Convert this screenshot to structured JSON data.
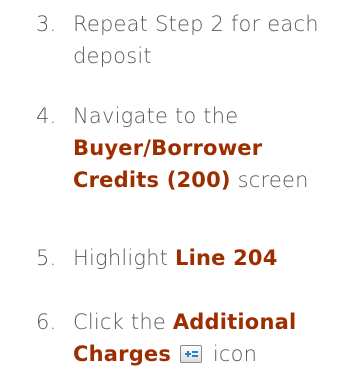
{
  "steps": [
    {
      "number": "3.",
      "text": "Repeat Step 2 for each deposit"
    },
    {
      "number": "4.",
      "prefix": "Navigate to the ",
      "highlight": "Buyer/Borrower Credits (200)",
      "suffix": " screen"
    },
    {
      "number": "5.",
      "prefix": "Highlight ",
      "highlight": "Line 204"
    },
    {
      "number": "6.",
      "prefix": "Click the ",
      "highlight": "Additional Charges",
      "suffix": " icon",
      "icon": "additional-charges-icon"
    }
  ],
  "colors": {
    "body_text": "#595959",
    "highlight": "#9c2e00",
    "icon_plus": "#2a7fd4",
    "icon_lines": "#2a7fd4"
  }
}
